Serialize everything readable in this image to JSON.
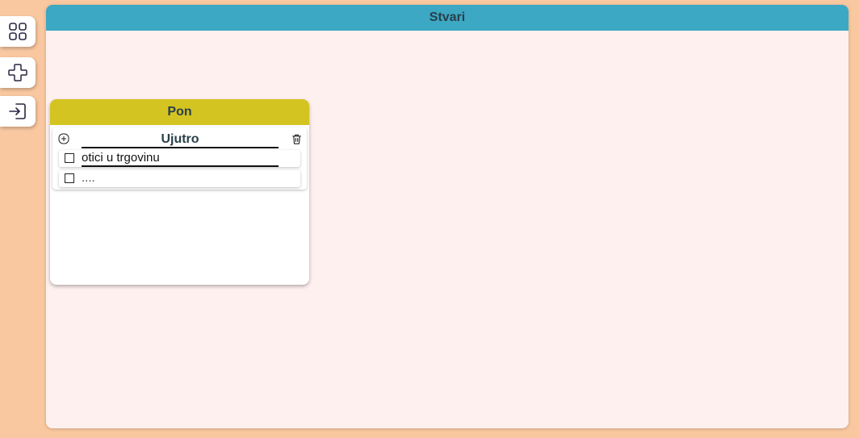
{
  "sidebar": {
    "buttons": [
      {
        "name": "grid",
        "icon": "grid-icon"
      },
      {
        "name": "add",
        "icon": "plus-icon"
      },
      {
        "name": "login",
        "icon": "login-icon"
      }
    ]
  },
  "board": {
    "title": "Stvari",
    "header_color": "#3ca8c3"
  },
  "days": [
    {
      "title": "Pon",
      "header_color": "#d4c422",
      "sections": [
        {
          "title": "Ujutro",
          "add_icon": "plus-square-icon",
          "delete_icon": "trash-icon",
          "tasks": [
            {
              "text": "otici u trgovinu",
              "checked": false
            },
            {
              "text": "....",
              "checked": false
            }
          ]
        }
      ]
    }
  ],
  "colors": {
    "page_background": "#fac8a0",
    "board_background": "#fff0f0"
  }
}
